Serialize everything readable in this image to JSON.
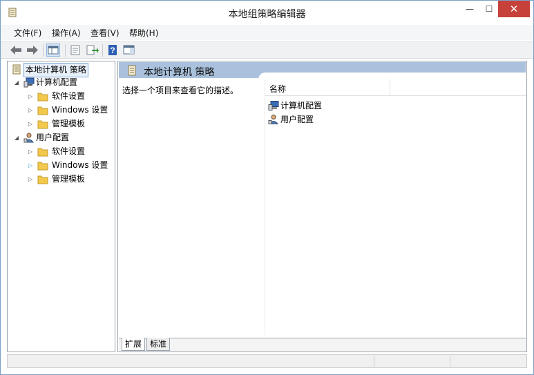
{
  "window": {
    "title": "本地组策略编辑器",
    "minimize": "—",
    "maximize": "☐",
    "close": "✕"
  },
  "menu": [
    {
      "label": "文件(F)"
    },
    {
      "label": "操作(A)"
    },
    {
      "label": "查看(V)"
    },
    {
      "label": "帮助(H)"
    }
  ],
  "toolbar": {
    "buttons": [
      "back-icon",
      "forward-icon",
      "show-hide-tree-icon",
      "properties-icon",
      "export-list-icon",
      "help-icon",
      "show-hide-action-pane-icon"
    ]
  },
  "tree": {
    "root": "本地计算机 策略",
    "computer": "计算机配置",
    "computer_children": [
      "软件设置",
      "Windows 设置",
      "管理模板"
    ],
    "user": "用户配置",
    "user_children": [
      "软件设置",
      "Windows 设置",
      "管理模板"
    ]
  },
  "detail": {
    "header": "本地计算机 策略",
    "description": "选择一个项目来查看它的描述。",
    "column_name": "名称",
    "items": [
      "计算机配置",
      "用户配置"
    ]
  },
  "tabs": [
    "扩展",
    "标准"
  ],
  "colors": {
    "accent_header": "#a9c1dc",
    "close_button": "#c7413b",
    "folder": "#f2c94c"
  }
}
